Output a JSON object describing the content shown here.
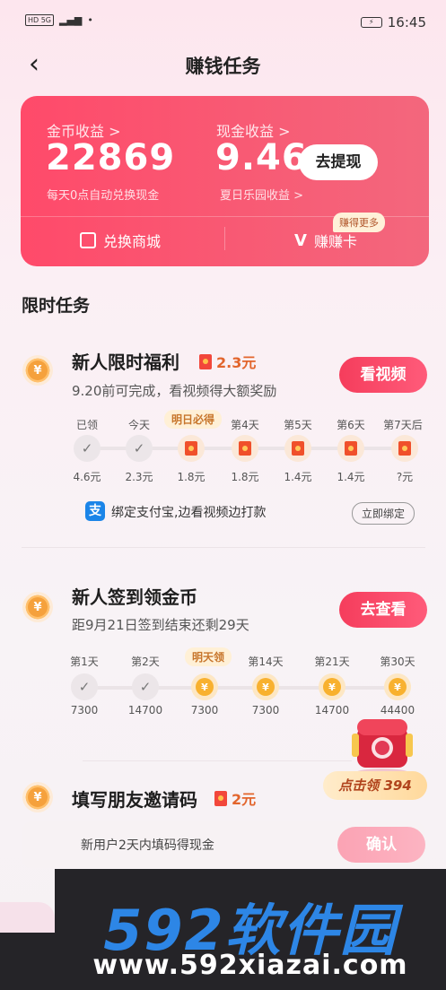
{
  "statusbar": {
    "left": "HD 5G",
    "time": "16:45",
    "battery": "⚡"
  },
  "header": {
    "title": "赚钱任务"
  },
  "card": {
    "coin_label": "金币收益 >",
    "coin_value": "22869",
    "coin_note": "每天0点自动兑换现金",
    "cash_label": "现金收益 >",
    "cash_value": "9.46",
    "cash_note": "夏日乐园收益 >",
    "withdraw": "去提现",
    "mall": "兑换商城",
    "earn_card": "赚赚卡",
    "more_badge": "赚得更多"
  },
  "section_title": "限时任务",
  "task1": {
    "title": "新人限时福利",
    "reward": "2.3元",
    "sub": "9.20前可完成，看视频得大额奖励",
    "button": "看视频",
    "highlight": "明日必得",
    "days": [
      {
        "label": "已领",
        "value": "4.6元",
        "state": "check"
      },
      {
        "label": "今天",
        "value": "2.3元",
        "state": "check"
      },
      {
        "label": "",
        "value": "1.8元",
        "state": "pkt"
      },
      {
        "label": "第4天",
        "value": "1.8元",
        "state": "pkt"
      },
      {
        "label": "第5天",
        "value": "1.4元",
        "state": "pkt"
      },
      {
        "label": "第6天",
        "value": "1.4元",
        "state": "pkt"
      },
      {
        "label": "第7天后",
        "value": "?元",
        "state": "pkt"
      }
    ],
    "alipay_text": "绑定支付宝,边看视频边打款",
    "bind_button": "立即绑定"
  },
  "task2": {
    "title": "新人签到领金币",
    "sub": "距9月21日签到结束还剩29天",
    "button": "去查看",
    "highlight": "明天领",
    "days": [
      {
        "label": "第1天",
        "value": "7300",
        "state": "check"
      },
      {
        "label": "第2天",
        "value": "14700",
        "state": "check"
      },
      {
        "label": "",
        "value": "7300",
        "state": "gold"
      },
      {
        "label": "第14天",
        "value": "7300",
        "state": "gold"
      },
      {
        "label": "第21天",
        "value": "14700",
        "state": "gold"
      },
      {
        "label": "第30天",
        "value": "44400",
        "state": "gold"
      }
    ]
  },
  "floating": {
    "claim": "点击领 394"
  },
  "task3": {
    "title": "填写朋友邀请码",
    "reward": "2元",
    "field_text": "新用户2天内填码得现金",
    "button": "确认"
  },
  "watermark": {
    "top": "592软件园",
    "bottom": "www.592xiazai.com"
  },
  "colors": {
    "accent": "#f53d5c",
    "card": "#ff4a6a",
    "coin": "#f5a13c"
  }
}
